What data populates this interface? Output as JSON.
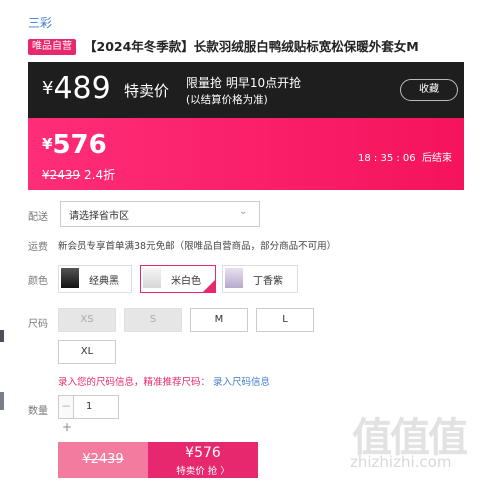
{
  "brand": "三彩",
  "badge": "唯品自营",
  "product_title": "【2024年冬季款】长款羽绒服白鸭绒贴标宽松保暖外套女M",
  "special": {
    "currency": "¥",
    "price": "489",
    "label": "特卖价",
    "limit_text": "限量抢 明早10点开抢",
    "note": "(以结算价格为准)",
    "favorite": "收藏"
  },
  "flash": {
    "currency": "¥",
    "price": "576",
    "orig_price": "¥2439",
    "discount": "2.4折",
    "timer": "18 : 35 : 06",
    "timer_suffix": "后结束"
  },
  "delivery": {
    "label": "配送",
    "placeholder": "请选择省市区",
    "chevron_icon": "chevron-down-icon"
  },
  "shipping": {
    "label": "运费",
    "text": "新会员专享首单满38元免邮（限唯品自营商品，部分商品不可用）"
  },
  "colors": {
    "label": "颜色",
    "options": [
      {
        "name": "经典黑",
        "selected": false
      },
      {
        "name": "米白色",
        "selected": true
      },
      {
        "name": "丁香紫",
        "selected": false
      }
    ]
  },
  "sizes": {
    "label": "尺码",
    "options": [
      {
        "name": "XS",
        "disabled": true
      },
      {
        "name": "S",
        "disabled": true
      },
      {
        "name": "M",
        "disabled": false
      },
      {
        "name": "L",
        "disabled": false
      },
      {
        "name": "XL",
        "disabled": false
      }
    ],
    "hint": "录入您的尺码信息，精准推荐尺码：",
    "link": "录入尺码信息"
  },
  "quantity": {
    "label": "数量",
    "minus": "−",
    "value": "1",
    "plus": "+"
  },
  "buttons": {
    "orig_price": "¥2439",
    "buy_price": "¥576",
    "buy_label": "特卖价 抢 〉"
  },
  "watermark": {
    "logo": "值值值",
    "text": "zhizhizhi.com"
  },
  "colors_theme": {
    "accent": "#e8286e",
    "dark_band": "#1e1e1e",
    "link": "#3e7ec9"
  }
}
